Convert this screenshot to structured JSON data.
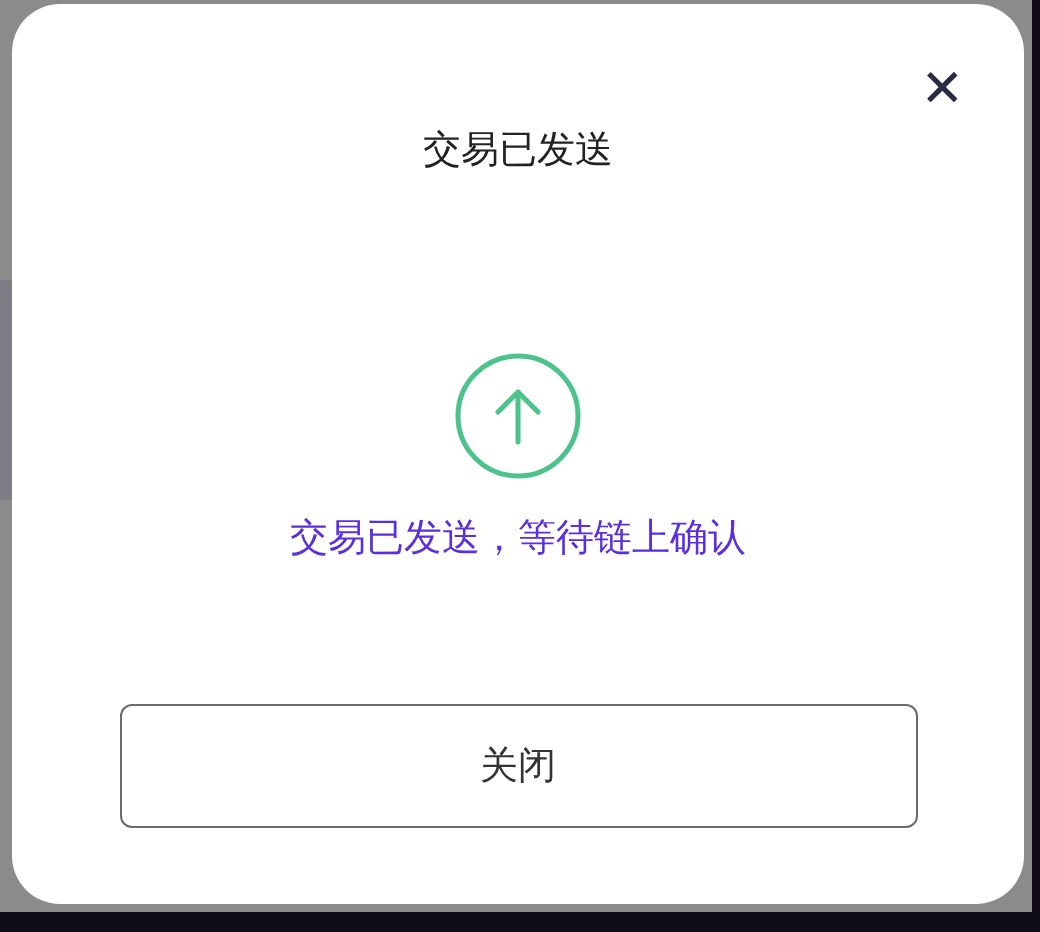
{
  "dialog": {
    "title": "交易已发送",
    "close": "✕",
    "message": "交易已发送，等待链上确认",
    "buttons": [
      "关闭"
    ]
  }
}
